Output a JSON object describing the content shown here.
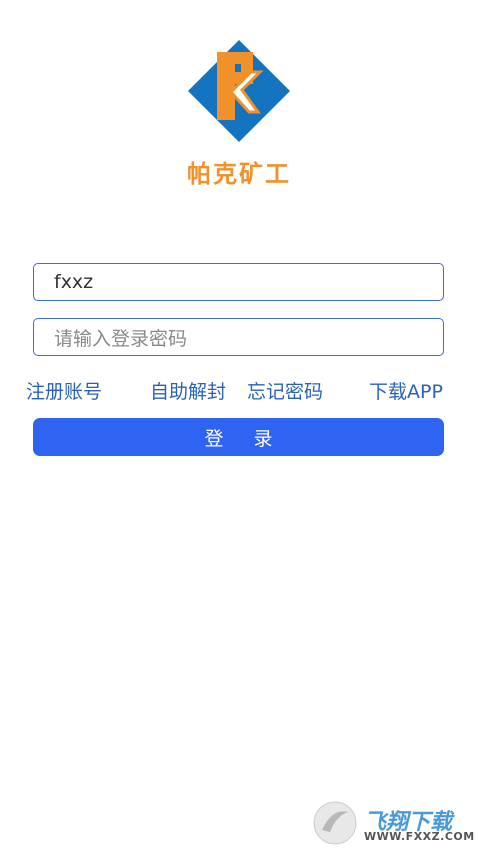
{
  "brand": {
    "name": "帕克矿工"
  },
  "login_form": {
    "username_value": "fxxz",
    "password_placeholder": "请输入登录密码",
    "links": {
      "register": "注册账号",
      "self_unlock": "自助解封",
      "forgot_password": "忘记密码",
      "download_app": "下载APP"
    },
    "login_button": "登 录"
  },
  "watermark": {
    "title": "飞翔下载",
    "url": "WWW.FXXZ.COM"
  },
  "colors": {
    "brand_orange": "#f0912a",
    "logo_blue": "#1473bf",
    "link_blue": "#2a62b8",
    "button_blue": "#2f63f1",
    "input_border": "#3b6fd4"
  }
}
